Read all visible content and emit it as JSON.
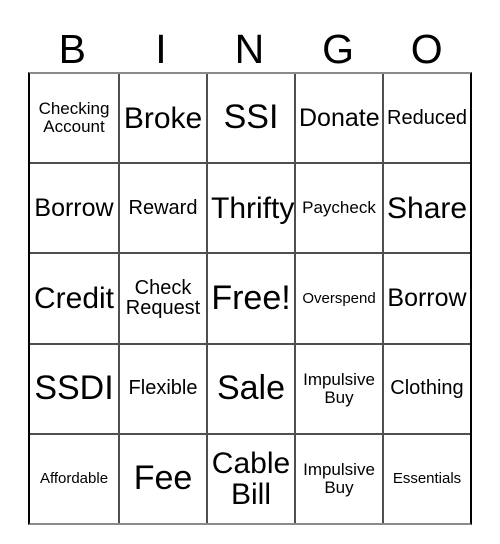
{
  "card": {
    "title": "BINGO",
    "headers": [
      "B",
      "I",
      "N",
      "G",
      "O"
    ],
    "free_space_label": "Free!",
    "rows": [
      [
        {
          "text": "Checking\nAccount",
          "size": "s"
        },
        {
          "text": "Broke",
          "size": "xl"
        },
        {
          "text": "SSI",
          "size": "xxl"
        },
        {
          "text": "Donate",
          "size": "l"
        },
        {
          "text": "Reduced",
          "size": "m"
        }
      ],
      [
        {
          "text": "Borrow",
          "size": "l"
        },
        {
          "text": "Reward",
          "size": "m"
        },
        {
          "text": "Thrifty",
          "size": "xl"
        },
        {
          "text": "Paycheck",
          "size": "s"
        },
        {
          "text": "Share",
          "size": "xl"
        }
      ],
      [
        {
          "text": "Credit",
          "size": "xl"
        },
        {
          "text": "Check\nRequest",
          "size": "m"
        },
        {
          "text": "Free!",
          "size": "xxl"
        },
        {
          "text": "Overspend",
          "size": "xs"
        },
        {
          "text": "Borrow",
          "size": "l"
        }
      ],
      [
        {
          "text": "SSDI",
          "size": "xxl"
        },
        {
          "text": "Flexible",
          "size": "m"
        },
        {
          "text": "Sale",
          "size": "xxl"
        },
        {
          "text": "Impulsive\nBuy",
          "size": "s"
        },
        {
          "text": "Clothing",
          "size": "m"
        }
      ],
      [
        {
          "text": "Affordable",
          "size": "xs"
        },
        {
          "text": "Fee",
          "size": "xxl"
        },
        {
          "text": "Cable\nBill",
          "size": "xl"
        },
        {
          "text": "Impulsive\nBuy",
          "size": "s"
        },
        {
          "text": "Essentials",
          "size": "xs"
        }
      ]
    ]
  },
  "colors": {
    "background": "#ffffff",
    "text": "#000000",
    "grid_line": "#4f4f4f",
    "outer_border_dark": "#000000",
    "outer_border_light": "#8a8a8a"
  }
}
